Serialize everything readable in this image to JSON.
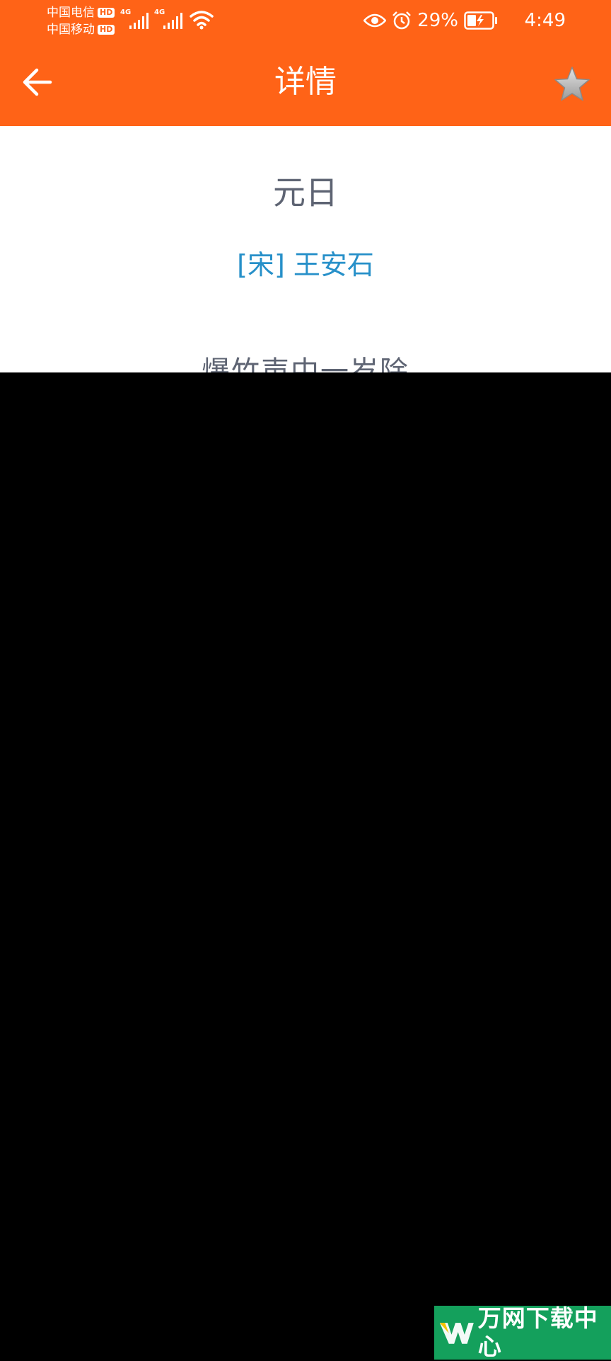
{
  "status_bar": {
    "carrier_1": "中国电信",
    "carrier_2": "中国移动",
    "hd_label": "HD",
    "network_type": "4G",
    "battery_percent": "29%",
    "time": "4:49",
    "icons": [
      "signal-icon",
      "wifi-icon",
      "eye-icon",
      "alarm-icon",
      "battery-charging-icon"
    ]
  },
  "app_bar": {
    "title": "详情",
    "back_icon": "arrow-left-icon",
    "favorite_icon": "star-icon"
  },
  "poem": {
    "title": "元日",
    "author": "[宋] 王安石",
    "first_line": "爆竹声中一岁除"
  },
  "watermark": {
    "text": "万网下载中心"
  },
  "colors": {
    "app_bar": "#FF6317",
    "title_text": "#5E6473",
    "author_text": "#2790C9",
    "watermark_bg": "#14A05C"
  }
}
